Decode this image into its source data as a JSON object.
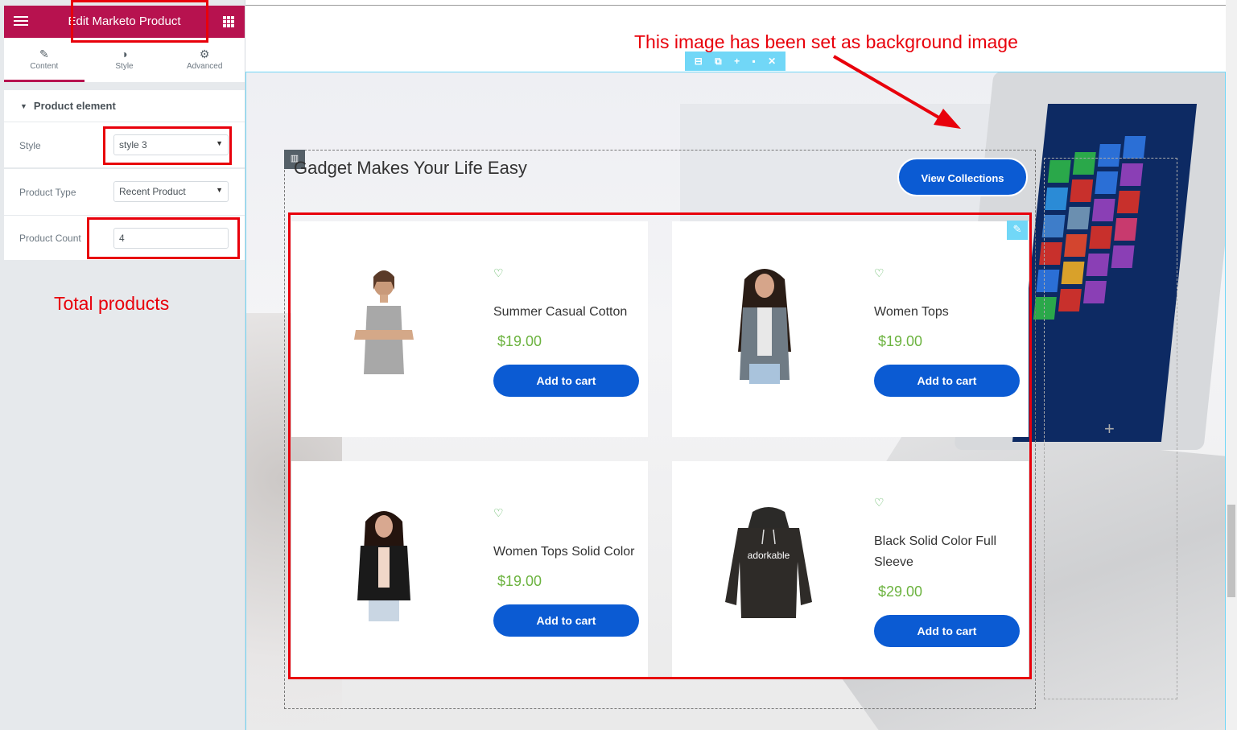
{
  "panel": {
    "title": "Edit Marketo Product",
    "tabs": [
      {
        "label": "Content",
        "icon": "pencil-icon"
      },
      {
        "label": "Style",
        "icon": "contrast-icon"
      },
      {
        "label": "Advanced",
        "icon": "gear-icon"
      }
    ],
    "section_title": "Product element",
    "controls": {
      "style_label": "Style",
      "style_value": "style 3",
      "ptype_label": "Product Type",
      "ptype_value": "Recent Product",
      "pcount_label": "Product Count",
      "pcount_value": "4"
    }
  },
  "annotations": {
    "total_products": "Total products",
    "background_note": "This image has been set as background image",
    "color": "#e8000b"
  },
  "preview": {
    "heading": "Gadget Makes Your Life Easy",
    "view_button": "View Collections",
    "products": [
      {
        "name": "Summer Casual Cotton",
        "price": "$19.00",
        "cart": "Add to cart"
      },
      {
        "name": "Women Tops",
        "price": "$19.00",
        "cart": "Add to cart"
      },
      {
        "name": "Women Tops Solid Color",
        "price": "$19.00",
        "cart": "Add to cart"
      },
      {
        "name": "Black Solid Color Full Sleeve",
        "price": "$29.00",
        "cart": "Add to cart"
      }
    ],
    "hoodie_print": "adorkable",
    "colors": {
      "brand": "#b7124f",
      "button": "#0b5bd3",
      "price": "#6cb33f",
      "editor_accent": "#71d7f7"
    }
  }
}
